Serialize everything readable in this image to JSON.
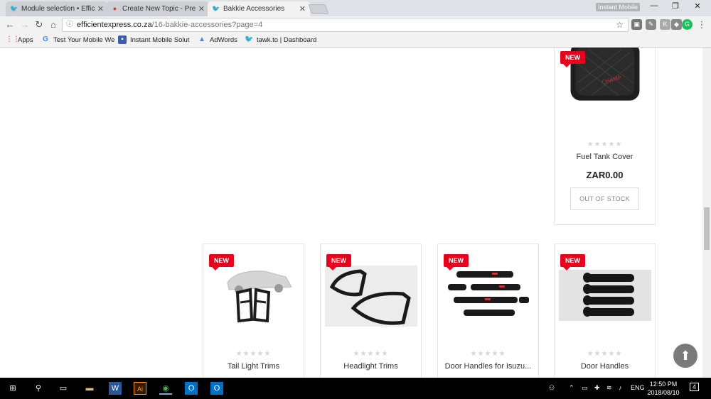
{
  "browser": {
    "tabs": [
      {
        "title": "Module selection • Efficie",
        "active": false
      },
      {
        "title": "Create New Topic - Presta",
        "active": false
      },
      {
        "title": "Bakkie Accessories",
        "active": true
      }
    ],
    "profile_label": "Instant Mobile",
    "url_host": "efficientexpress.co.za",
    "url_path": "/16-bakkie-accessories?page=4",
    "bookmarks": [
      {
        "label": "Apps",
        "icon": "apps-grid-icon"
      },
      {
        "label": "Test Your Mobile We",
        "icon": "google-icon"
      },
      {
        "label": "Instant Mobile Solut",
        "icon": "site-icon"
      },
      {
        "label": "AdWords",
        "icon": "adwords-icon"
      },
      {
        "label": "tawk.to | Dashboard",
        "icon": "tawk-icon"
      }
    ]
  },
  "products": [
    {
      "badge": "NEW",
      "name": "Fuel Tank Cover",
      "price": "ZAR0.00",
      "button": "OUT OF STOCK",
      "stars": "★★★★★"
    },
    {
      "badge": "NEW",
      "name": "Tail Light Trims",
      "stars": "★★★★★"
    },
    {
      "badge": "NEW",
      "name": "Headlight Trims",
      "stars": "★★★★★"
    },
    {
      "badge": "NEW",
      "name": "Door Handles for Isuzu...",
      "stars": "★★★★★"
    },
    {
      "badge": "NEW",
      "name": "Door Handles",
      "stars": "★★★★★"
    }
  ],
  "taskbar": {
    "language": "ENG",
    "time": "12:50 PM",
    "date": "2018/08/10",
    "notification_count": "4"
  }
}
